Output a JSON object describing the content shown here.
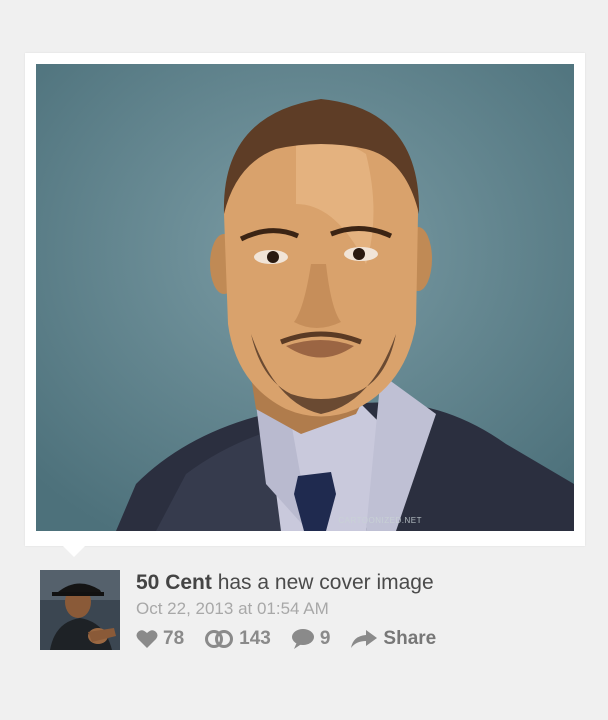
{
  "post": {
    "author": "50 Cent",
    "action_text": " has a new cover image",
    "timestamp": "Oct 22, 2013 at 01:54 AM",
    "cover_watermark": "CARTOONIZED.NET"
  },
  "actions": {
    "likes": "78",
    "reblogs": "143",
    "comments": "9",
    "share_label": "Share"
  },
  "icons": {
    "like": "heart-icon",
    "reblog": "reblog-rings-icon",
    "comment": "speech-bubble-icon",
    "share": "share-arrow-icon"
  },
  "colors": {
    "background": "#f0f0f0",
    "card": "#ffffff",
    "cover_background": "#5a7e88",
    "text_primary": "#444444",
    "text_muted": "#a8a8a8",
    "icon_gray": "#8a8a8a"
  }
}
